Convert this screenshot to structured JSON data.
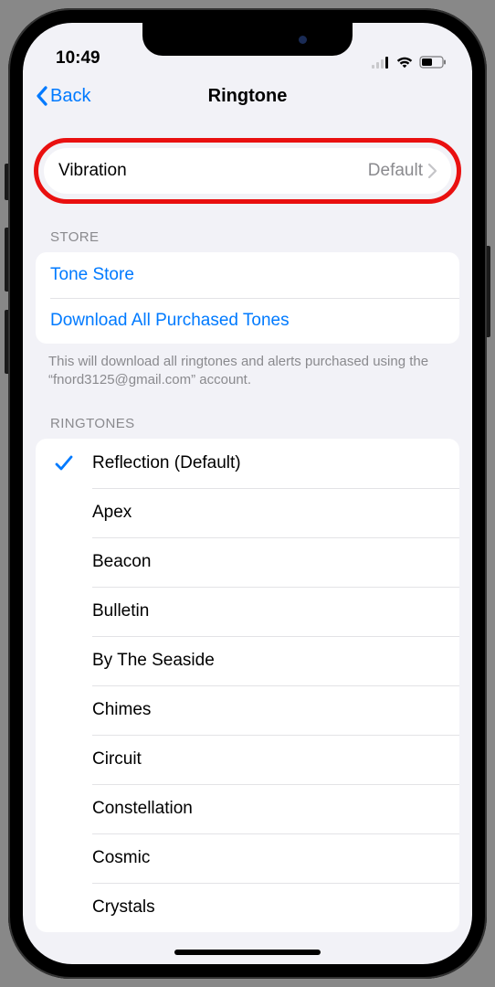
{
  "status": {
    "time": "10:49"
  },
  "nav": {
    "back": "Back",
    "title": "Ringtone"
  },
  "vibration": {
    "label": "Vibration",
    "value": "Default"
  },
  "store": {
    "header": "STORE",
    "tone_store": "Tone Store",
    "download_all": "Download All Purchased Tones",
    "footer": "This will download all ringtones and alerts purchased using the “fnord3125@gmail.com” account."
  },
  "ringtones": {
    "header": "RINGTONES",
    "items": [
      {
        "label": "Reflection (Default)",
        "selected": true
      },
      {
        "label": "Apex",
        "selected": false
      },
      {
        "label": "Beacon",
        "selected": false
      },
      {
        "label": "Bulletin",
        "selected": false
      },
      {
        "label": "By The Seaside",
        "selected": false
      },
      {
        "label": "Chimes",
        "selected": false
      },
      {
        "label": "Circuit",
        "selected": false
      },
      {
        "label": "Constellation",
        "selected": false
      },
      {
        "label": "Cosmic",
        "selected": false
      },
      {
        "label": "Crystals",
        "selected": false
      }
    ]
  }
}
